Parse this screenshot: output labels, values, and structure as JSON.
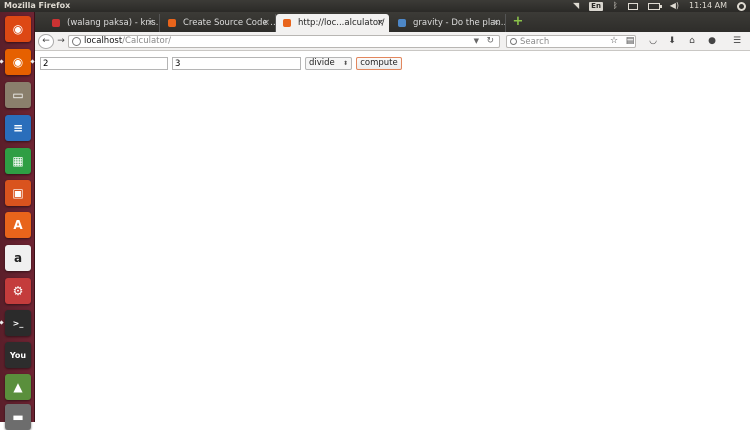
{
  "panel": {
    "title": "Mozilla Firefox",
    "keyboard_layout": "En",
    "time": "11:14 AM"
  },
  "launcher": {
    "apps": [
      {
        "name": "dash-home-icon",
        "glyph": "◉",
        "color": "#dd4814"
      },
      {
        "name": "firefox-icon",
        "glyph": "◉",
        "color": "#e66000"
      },
      {
        "name": "files-icon",
        "glyph": "▭",
        "color": "#8a7f6c"
      },
      {
        "name": "libreoffice-writer-icon",
        "glyph": "≡",
        "color": "#2a6ebb"
      },
      {
        "name": "libreoffice-calc-icon",
        "glyph": "▦",
        "color": "#2f9e44"
      },
      {
        "name": "libreoffice-impress-icon",
        "glyph": "▣",
        "color": "#d9531e"
      },
      {
        "name": "software-center-icon",
        "glyph": "A",
        "color": "#e8641b"
      },
      {
        "name": "amazon-icon",
        "glyph": "a",
        "color": "#f0f0f0"
      },
      {
        "name": "system-settings-icon",
        "glyph": "⚙",
        "color": "#c43c3c"
      },
      {
        "name": "terminal-icon",
        "glyph": ">_",
        "color": "#2b2b2b"
      },
      {
        "name": "youtube-icon",
        "glyph": "You",
        "color": "#2d2d2d"
      },
      {
        "name": "app-icon",
        "glyph": "▲",
        "color": "#5a8f3c"
      },
      {
        "name": "app-icon-2",
        "glyph": "▬",
        "color": "#6d6d6d"
      }
    ]
  },
  "tabs": [
    {
      "label": "(walang paksa) - kris...",
      "favicon_color": "#c33"
    },
    {
      "label": "Create Source Code ...",
      "favicon_color": "#e8641b"
    },
    {
      "label": "http://loc...alculator/",
      "favicon_color": "#e8641b"
    },
    {
      "label": "gravity - Do the plan...",
      "favicon_color": "#4d87c7"
    }
  ],
  "urlbar": {
    "host": "localhost",
    "path": "/Calculator/"
  },
  "search": {
    "placeholder": "Search"
  },
  "calculator": {
    "operand1": "2",
    "operand2": "3",
    "operation": "divide",
    "compute_label": "compute"
  }
}
